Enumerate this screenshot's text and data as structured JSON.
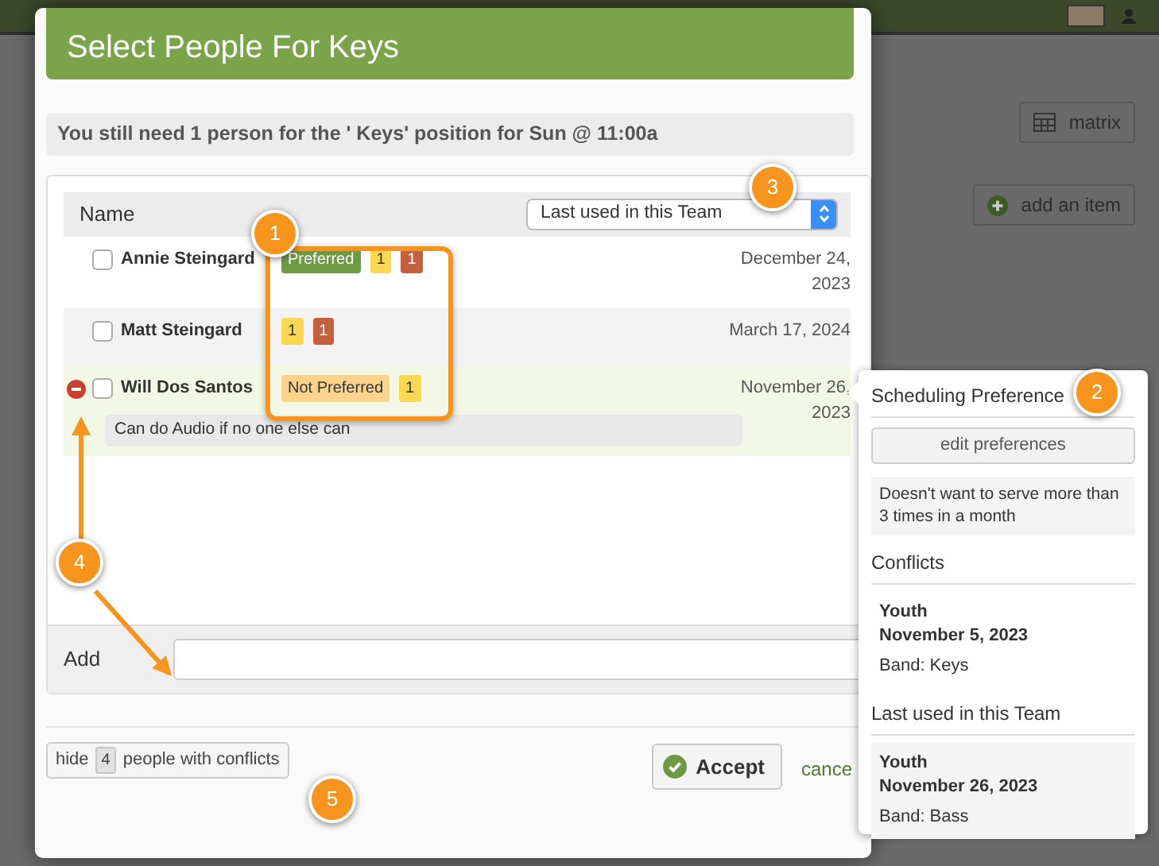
{
  "background": {
    "toolbar_buttons": [
      {
        "label": "matrix",
        "kind": "matrix"
      },
      {
        "label": "add an item",
        "kind": "add"
      }
    ]
  },
  "dialog": {
    "title": "Select People For Keys",
    "notice": "You still need 1 person for the ' Keys' position for Sun @ 11:00a",
    "sort_column": "Name",
    "sort_select": "Last used in this Team",
    "people": [
      {
        "name": "Annie Steingard",
        "checked": false,
        "removable": false,
        "active": false,
        "badges": [
          {
            "text": "Preferred",
            "kind": "preferred"
          },
          {
            "text": "1",
            "kind": "yellow"
          },
          {
            "text": "1",
            "kind": "red"
          }
        ],
        "date": "December 24, 2023"
      },
      {
        "name": "Matt Steingard",
        "checked": false,
        "removable": false,
        "active": false,
        "badges": [
          {
            "text": "1",
            "kind": "yellow"
          },
          {
            "text": "1",
            "kind": "red"
          }
        ],
        "date": "March 17, 2024"
      },
      {
        "name": "Will Dos Santos",
        "checked": false,
        "removable": true,
        "active": true,
        "badges": [
          {
            "text": "Not Preferred",
            "kind": "not_preferred"
          },
          {
            "text": "1",
            "kind": "yellow"
          }
        ],
        "date": "November 26, 2023",
        "note": "Can do Audio if no one else can"
      }
    ],
    "add_label": "Add",
    "hide_button": {
      "before": "hide",
      "count": "4",
      "after": "people with conflicts"
    },
    "accept": "Accept",
    "cancel": "cance"
  },
  "popover": {
    "title": "Scheduling Preference",
    "button": "edit preferences",
    "note": "Doesn't want to serve more than 3 times in a month",
    "sections": [
      {
        "heading": "Conflicts",
        "entries": [
          {
            "group": "Youth",
            "date": "November 5, 2023",
            "detail": "Band: Keys"
          }
        ]
      },
      {
        "heading": "Last used in this Team",
        "shaded": true,
        "entries": [
          {
            "group": "Youth",
            "date": "November 26, 2023",
            "detail": "Band: Bass"
          }
        ]
      }
    ]
  },
  "callouts": [
    "1",
    "2",
    "3",
    "4",
    "5"
  ]
}
